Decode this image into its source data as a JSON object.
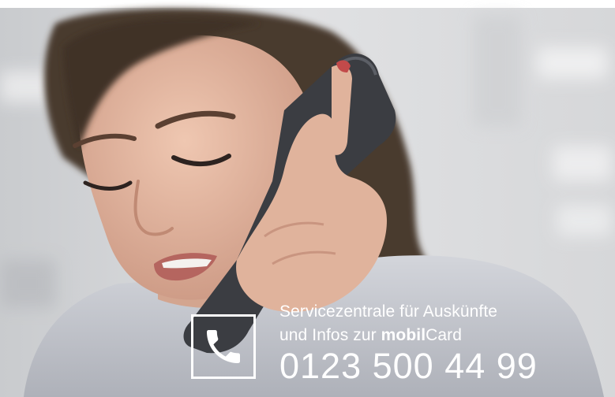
{
  "overlay": {
    "line1": "Servicezentrale für Auskünfte",
    "line2_prefix": "und Infos zur ",
    "line2_brand_bold": "mobil",
    "line2_brand_rest": "Card",
    "phone_number": "0123 500 44 99"
  },
  "colors": {
    "overlay_text": "#ffffff",
    "background_blur": "#d9dadc",
    "hair": "#4a3a2e",
    "skin": "#e2b9a3",
    "blouse": "#c9cbd1",
    "handset": "#3b3d42"
  },
  "icons": {
    "contact": "phone-handset-icon"
  }
}
